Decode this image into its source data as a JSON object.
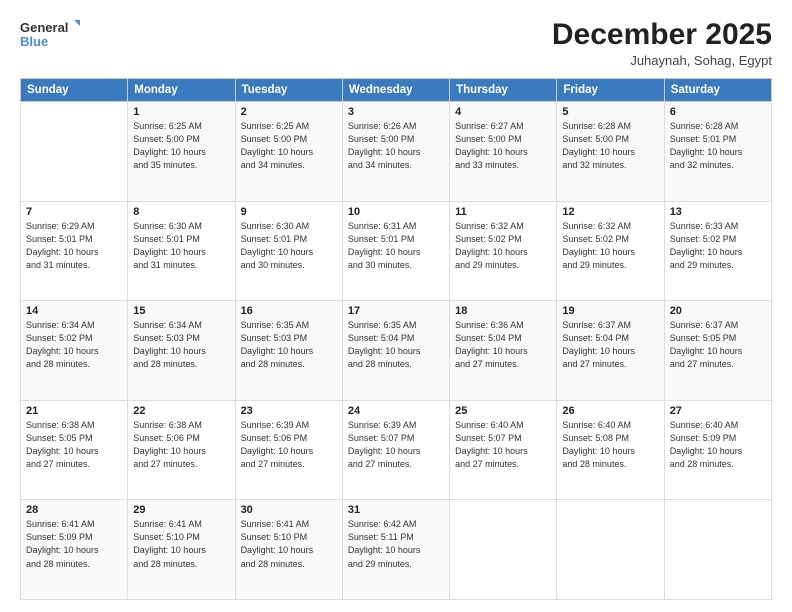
{
  "logo": {
    "line1": "General",
    "line2": "Blue"
  },
  "title": "December 2025",
  "location": "Juhaynah, Sohag, Egypt",
  "weekdays": [
    "Sunday",
    "Monday",
    "Tuesday",
    "Wednesday",
    "Thursday",
    "Friday",
    "Saturday"
  ],
  "weeks": [
    [
      {
        "day": "",
        "lines": []
      },
      {
        "day": "1",
        "lines": [
          "Sunrise: 6:25 AM",
          "Sunset: 5:00 PM",
          "Daylight: 10 hours",
          "and 35 minutes."
        ]
      },
      {
        "day": "2",
        "lines": [
          "Sunrise: 6:25 AM",
          "Sunset: 5:00 PM",
          "Daylight: 10 hours",
          "and 34 minutes."
        ]
      },
      {
        "day": "3",
        "lines": [
          "Sunrise: 6:26 AM",
          "Sunset: 5:00 PM",
          "Daylight: 10 hours",
          "and 34 minutes."
        ]
      },
      {
        "day": "4",
        "lines": [
          "Sunrise: 6:27 AM",
          "Sunset: 5:00 PM",
          "Daylight: 10 hours",
          "and 33 minutes."
        ]
      },
      {
        "day": "5",
        "lines": [
          "Sunrise: 6:28 AM",
          "Sunset: 5:00 PM",
          "Daylight: 10 hours",
          "and 32 minutes."
        ]
      },
      {
        "day": "6",
        "lines": [
          "Sunrise: 6:28 AM",
          "Sunset: 5:01 PM",
          "Daylight: 10 hours",
          "and 32 minutes."
        ]
      }
    ],
    [
      {
        "day": "7",
        "lines": [
          "Sunrise: 6:29 AM",
          "Sunset: 5:01 PM",
          "Daylight: 10 hours",
          "and 31 minutes."
        ]
      },
      {
        "day": "8",
        "lines": [
          "Sunrise: 6:30 AM",
          "Sunset: 5:01 PM",
          "Daylight: 10 hours",
          "and 31 minutes."
        ]
      },
      {
        "day": "9",
        "lines": [
          "Sunrise: 6:30 AM",
          "Sunset: 5:01 PM",
          "Daylight: 10 hours",
          "and 30 minutes."
        ]
      },
      {
        "day": "10",
        "lines": [
          "Sunrise: 6:31 AM",
          "Sunset: 5:01 PM",
          "Daylight: 10 hours",
          "and 30 minutes."
        ]
      },
      {
        "day": "11",
        "lines": [
          "Sunrise: 6:32 AM",
          "Sunset: 5:02 PM",
          "Daylight: 10 hours",
          "and 29 minutes."
        ]
      },
      {
        "day": "12",
        "lines": [
          "Sunrise: 6:32 AM",
          "Sunset: 5:02 PM",
          "Daylight: 10 hours",
          "and 29 minutes."
        ]
      },
      {
        "day": "13",
        "lines": [
          "Sunrise: 6:33 AM",
          "Sunset: 5:02 PM",
          "Daylight: 10 hours",
          "and 29 minutes."
        ]
      }
    ],
    [
      {
        "day": "14",
        "lines": [
          "Sunrise: 6:34 AM",
          "Sunset: 5:02 PM",
          "Daylight: 10 hours",
          "and 28 minutes."
        ]
      },
      {
        "day": "15",
        "lines": [
          "Sunrise: 6:34 AM",
          "Sunset: 5:03 PM",
          "Daylight: 10 hours",
          "and 28 minutes."
        ]
      },
      {
        "day": "16",
        "lines": [
          "Sunrise: 6:35 AM",
          "Sunset: 5:03 PM",
          "Daylight: 10 hours",
          "and 28 minutes."
        ]
      },
      {
        "day": "17",
        "lines": [
          "Sunrise: 6:35 AM",
          "Sunset: 5:04 PM",
          "Daylight: 10 hours",
          "and 28 minutes."
        ]
      },
      {
        "day": "18",
        "lines": [
          "Sunrise: 6:36 AM",
          "Sunset: 5:04 PM",
          "Daylight: 10 hours",
          "and 27 minutes."
        ]
      },
      {
        "day": "19",
        "lines": [
          "Sunrise: 6:37 AM",
          "Sunset: 5:04 PM",
          "Daylight: 10 hours",
          "and 27 minutes."
        ]
      },
      {
        "day": "20",
        "lines": [
          "Sunrise: 6:37 AM",
          "Sunset: 5:05 PM",
          "Daylight: 10 hours",
          "and 27 minutes."
        ]
      }
    ],
    [
      {
        "day": "21",
        "lines": [
          "Sunrise: 6:38 AM",
          "Sunset: 5:05 PM",
          "Daylight: 10 hours",
          "and 27 minutes."
        ]
      },
      {
        "day": "22",
        "lines": [
          "Sunrise: 6:38 AM",
          "Sunset: 5:06 PM",
          "Daylight: 10 hours",
          "and 27 minutes."
        ]
      },
      {
        "day": "23",
        "lines": [
          "Sunrise: 6:39 AM",
          "Sunset: 5:06 PM",
          "Daylight: 10 hours",
          "and 27 minutes."
        ]
      },
      {
        "day": "24",
        "lines": [
          "Sunrise: 6:39 AM",
          "Sunset: 5:07 PM",
          "Daylight: 10 hours",
          "and 27 minutes."
        ]
      },
      {
        "day": "25",
        "lines": [
          "Sunrise: 6:40 AM",
          "Sunset: 5:07 PM",
          "Daylight: 10 hours",
          "and 27 minutes."
        ]
      },
      {
        "day": "26",
        "lines": [
          "Sunrise: 6:40 AM",
          "Sunset: 5:08 PM",
          "Daylight: 10 hours",
          "and 28 minutes."
        ]
      },
      {
        "day": "27",
        "lines": [
          "Sunrise: 6:40 AM",
          "Sunset: 5:09 PM",
          "Daylight: 10 hours",
          "and 28 minutes."
        ]
      }
    ],
    [
      {
        "day": "28",
        "lines": [
          "Sunrise: 6:41 AM",
          "Sunset: 5:09 PM",
          "Daylight: 10 hours",
          "and 28 minutes."
        ]
      },
      {
        "day": "29",
        "lines": [
          "Sunrise: 6:41 AM",
          "Sunset: 5:10 PM",
          "Daylight: 10 hours",
          "and 28 minutes."
        ]
      },
      {
        "day": "30",
        "lines": [
          "Sunrise: 6:41 AM",
          "Sunset: 5:10 PM",
          "Daylight: 10 hours",
          "and 28 minutes."
        ]
      },
      {
        "day": "31",
        "lines": [
          "Sunrise: 6:42 AM",
          "Sunset: 5:11 PM",
          "Daylight: 10 hours",
          "and 29 minutes."
        ]
      },
      {
        "day": "",
        "lines": []
      },
      {
        "day": "",
        "lines": []
      },
      {
        "day": "",
        "lines": []
      }
    ]
  ]
}
